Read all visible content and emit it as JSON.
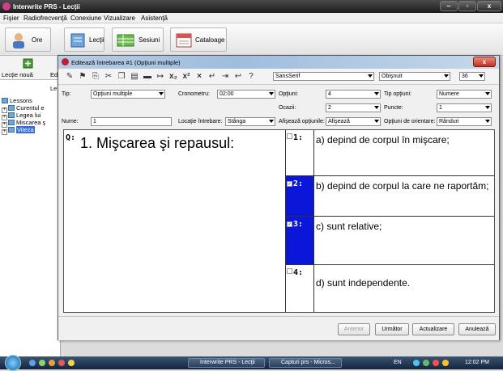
{
  "window": {
    "title": "Interwrite PRS - Lecţii",
    "min": "‒",
    "max": "▫",
    "close": "x"
  },
  "menu": [
    "Fişier",
    "Radiofrecvenţă",
    "Conexiune",
    "Vizualizare",
    "Asistenţă"
  ],
  "toolbar": {
    "ore": "Ore",
    "lectii": "Lecţii",
    "sesiuni": "Sesiuni",
    "cataloage": "Cataloage"
  },
  "left_panel": {
    "new_lesson": "Lecţie nouă",
    "edit_prefix": "Ed",
    "col_header": "Le",
    "tree": [
      {
        "label": "Lessons",
        "toggle": ""
      },
      {
        "label": "Curentul e",
        "toggle": "+"
      },
      {
        "label": "Legea lui",
        "toggle": "+"
      },
      {
        "label": "Miscarea ş",
        "toggle": "+"
      },
      {
        "label": "Viteza",
        "toggle": "+"
      }
    ]
  },
  "dialog": {
    "title": "Editează întrebarea #1 (Opţiuni multiple)",
    "close": "x",
    "font": "SansSerif",
    "style": "Obişnuit",
    "size": "36",
    "tip_label": "Tip:",
    "tip_value": "Opţiuni multiple",
    "cronometru_label": "Cronometru:",
    "cronometru_value": "02:00",
    "optiuni_label": "Opţiuni:",
    "optiuni_value": "4",
    "tip_optiuni_label": "Tip opţiuni:",
    "tip_optiuni_value": "Numere",
    "ocazii_label": "Ocazii:",
    "ocazii_value": "2",
    "puncte_label": "Puncte:",
    "puncte_value": "1",
    "nume_label": "Nume:",
    "nume_value": "1",
    "locatie_label": "Locaţie întrebare:",
    "locatie_value": "Stânga",
    "afiseaza_label": "Afişează opţiunile:",
    "afiseaza_value": "Afişează",
    "orientare_label": "Opţiuni de orientare:",
    "orientare_value": "Rânduri",
    "question_prefix": "Q:",
    "question": "1. Mişcarea şi repausul:",
    "options": [
      {
        "num": "1:",
        "text": "a) depind de corpul în mişcare;",
        "selected": false
      },
      {
        "num": "2:",
        "text": "b) depind de corpul la care ne raportăm;",
        "selected": true
      },
      {
        "num": "3:",
        "text": "c) sunt relative;",
        "selected": true
      },
      {
        "num": "4:",
        "text": "d) sunt independente.",
        "selected": false
      }
    ],
    "buttons": {
      "prev": "Anterior",
      "next": "Următor",
      "update": "Actualizare",
      "cancel": "Anulează"
    }
  },
  "taskbar": {
    "items": [
      "Interwrite PRS - Lecţii",
      "Capturi prs - Micros..."
    ],
    "lang": "EN",
    "time": "12:02 PM"
  },
  "colors": {
    "selected_option": "#0a17d8",
    "title_bar": "#1d1d1d"
  }
}
